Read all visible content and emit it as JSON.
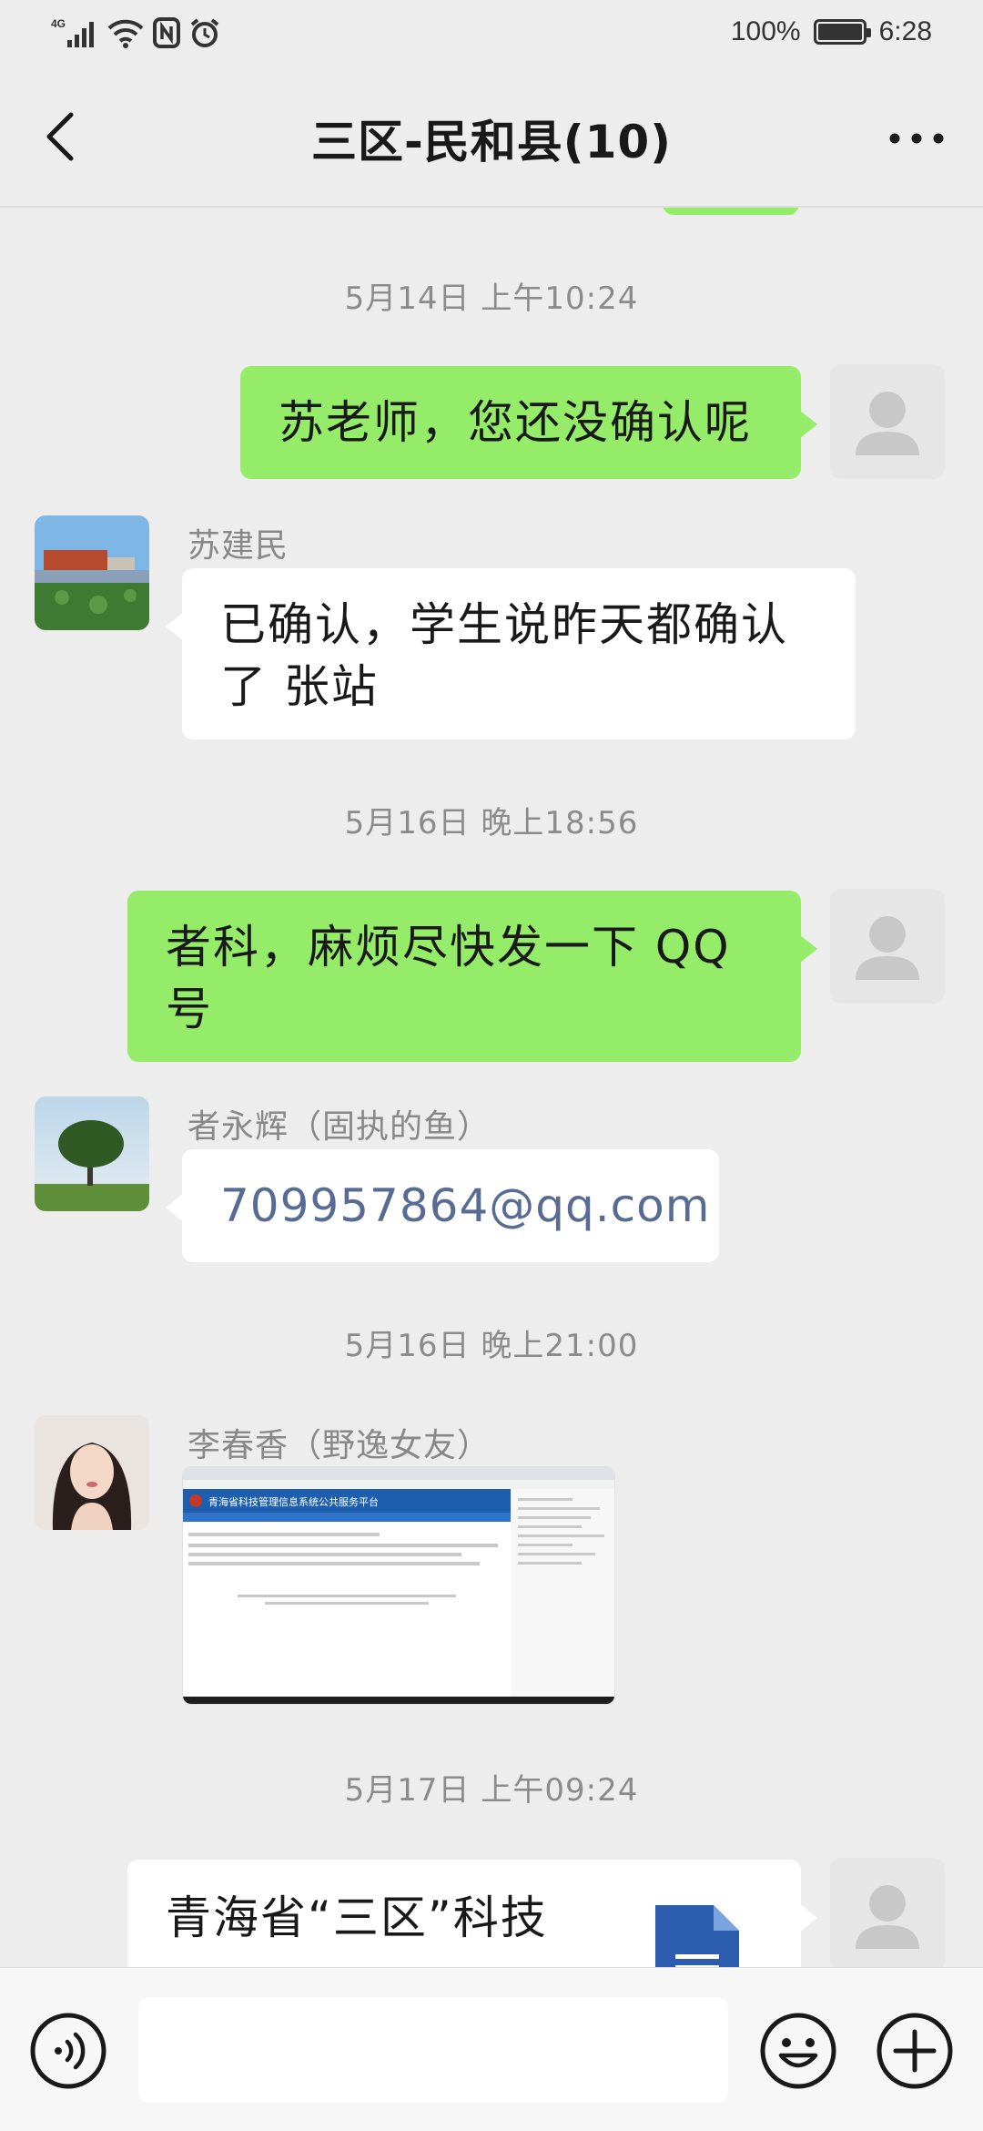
{
  "status_bar": {
    "network": "4G",
    "battery_percent": "100%",
    "battery_level": 1.0,
    "time": "6:28"
  },
  "header": {
    "title": "三区-民和县(10)"
  },
  "messages": {
    "t1": "5月14日 上午10:24",
    "m1": "苏老师，您还没确认呢",
    "m2_sender": "苏建民",
    "m2": "已确认，学生说昨天都确认了 张站",
    "t2": "5月16日 晚上18:56",
    "m3": "者科，麻烦尽快发一下 QQ号",
    "m4_sender": "者永辉（固执的鱼）",
    "m4": "709957864@qq.com",
    "t3": "5月16日 晚上21:00",
    "m5_sender": "李春香（野逸女友）",
    "t4": "5月17日 上午09:24",
    "m6_title": "青海省“三区”科技"
  },
  "screenshot_thumb": {
    "banner": "青海省科技管理信息系统公共服务平台"
  },
  "colors": {
    "self_bubble": "#95ec69",
    "other_bubble": "#ffffff",
    "background": "#ededed",
    "link": "#576b95"
  },
  "icons": {
    "back": "chevron-left-icon",
    "more": "more-dots-icon",
    "voice": "voice-icon",
    "emoji": "emoji-icon",
    "plus": "plus-icon"
  }
}
